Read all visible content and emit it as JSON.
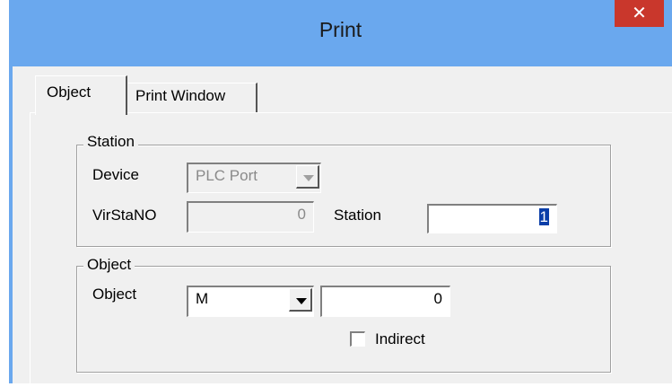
{
  "window": {
    "title": "Print",
    "close_glyph": "✕"
  },
  "tabs": [
    {
      "label": "Object",
      "active": true
    },
    {
      "label": "Print Window",
      "active": false
    }
  ],
  "station_group": {
    "title": "Station",
    "device_label": "Device",
    "device_value": "PLC Port",
    "virstano_label": "VirStaNO",
    "virstano_value": "0",
    "station_label": "Station",
    "station_value": "1"
  },
  "object_group": {
    "title": "Object",
    "object_label": "Object",
    "object_type_value": "M",
    "object_address_value": "0",
    "indirect_label": "Indirect",
    "indirect_checked": false
  },
  "icons": {
    "close": "close-icon",
    "dropdown": "chevron-down-icon"
  },
  "colors": {
    "titlebar": "#6aa8ee",
    "close": "#c9372c",
    "selection": "#0a3ea8"
  }
}
